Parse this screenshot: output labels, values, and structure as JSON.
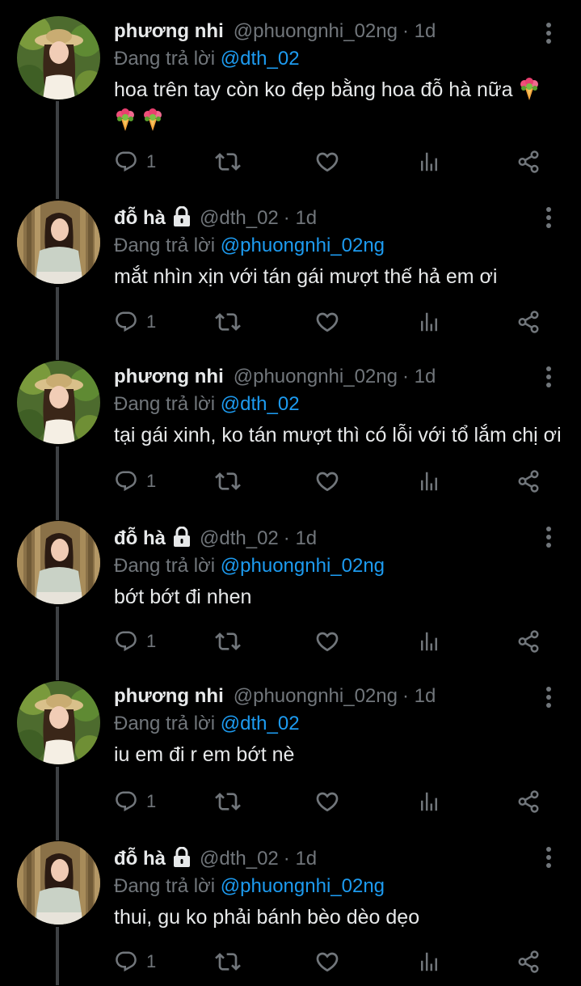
{
  "colors": {
    "background": "#000000",
    "text_primary": "#e7e9ea",
    "text_secondary": "#71767b",
    "link": "#1d9bf0",
    "thread_line": "#3e4144"
  },
  "icons": {
    "reply": "reply-icon",
    "retweet": "retweet-icon",
    "like": "heart-icon",
    "views": "analytics-icon",
    "share": "share-icon",
    "more": "more-vertical-icon",
    "protected": "lock-icon",
    "emoji": "bouquet-emoji"
  },
  "replying_label": "Đang trả lời",
  "tweets": [
    {
      "name": "phương nhi",
      "handle": "@phuongnhi_02ng",
      "time": "· 1d",
      "mention": "@dth_02",
      "text_line1": "hoa trên tay còn ko đẹp bằng hoa đỗ hà nữa",
      "reply_count": "1",
      "protected": false,
      "emoji_after_text": true
    },
    {
      "name": "đỗ hà",
      "handle": "@dth_02",
      "time": "· 1d",
      "mention": "@phuongnhi_02ng",
      "text_line1": "mắt nhìn xịn với tán gái mượt thế hả em ơi",
      "reply_count": "1",
      "protected": true
    },
    {
      "name": "phương nhi",
      "handle": "@phuongnhi_02ng",
      "time": "· 1d",
      "mention": "@dth_02",
      "text_line1": "tại gái xinh, ko tán mượt thì có lỗi với tổ lắm chị ơi",
      "reply_count": "1",
      "protected": false
    },
    {
      "name": "đỗ hà",
      "handle": "@dth_02",
      "time": "· 1d",
      "mention": "@phuongnhi_02ng",
      "text_line1": "bớt bớt đi nhen",
      "reply_count": "1",
      "protected": true
    },
    {
      "name": "phương nhi",
      "handle": "@phuongnhi_02ng",
      "time": "· 1d",
      "mention": "@dth_02",
      "text_line1": "iu em đi r em bớt nè",
      "reply_count": "1",
      "protected": false
    },
    {
      "name": "đỗ hà",
      "handle": "@dth_02",
      "time": "· 1d",
      "mention": "@phuongnhi_02ng",
      "text_line1": "thui, gu ko phải bánh bèo dèo dẹo",
      "reply_count": "1",
      "protected": true
    }
  ]
}
